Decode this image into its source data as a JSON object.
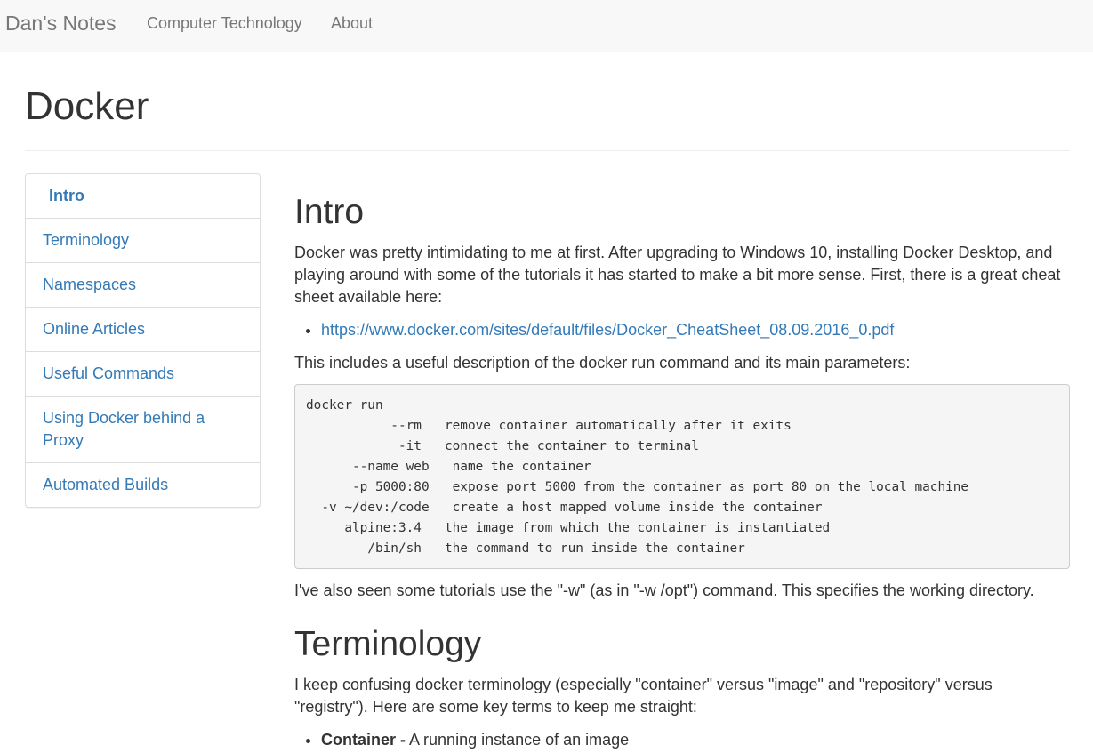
{
  "navbar": {
    "brand": "Dan's Notes",
    "links": [
      "Computer Technology",
      "About"
    ]
  },
  "page": {
    "title": "Docker"
  },
  "sidebar": {
    "items": [
      {
        "label": "Intro",
        "active": true
      },
      {
        "label": "Terminology"
      },
      {
        "label": "Namespaces"
      },
      {
        "label": "Online Articles"
      },
      {
        "label": "Useful Commands"
      },
      {
        "label": "Using Docker behind a Proxy"
      },
      {
        "label": "Automated Builds"
      }
    ]
  },
  "intro": {
    "heading": "Intro",
    "paragraph1": "Docker was pretty intimidating to me at first. After upgrading to Windows 10, installing Docker Desktop, and playing around with some of the tutorials it has started to make a bit more sense. First, there is a great cheat sheet available here:",
    "link": "https://www.docker.com/sites/default/files/Docker_CheatSheet_08.09.2016_0.pdf",
    "paragraph2": "This includes a useful description of the docker run command and its main parameters:",
    "code": "docker run\n           --rm   remove container automatically after it exits\n            -it   connect the container to terminal\n      --name web   name the container\n      -p 5000:80   expose port 5000 from the container as port 80 on the local machine\n  -v ~/dev:/code   create a host mapped volume inside the container\n     alpine:3.4   the image from which the container is instantiated\n        /bin/sh   the command to run inside the container",
    "paragraph3": "I've also seen some tutorials use the \"-w\" (as in \"-w /opt\") command. This specifies the working directory."
  },
  "terminology": {
    "heading": "Terminology",
    "paragraph": "I keep confusing docker terminology (especially \"container\" versus \"image\" and \"repository\" versus \"registry\"). Here are some key terms to keep me straight:",
    "terms": [
      {
        "term": "Container -",
        "definition": " A running instance of an image"
      }
    ]
  }
}
